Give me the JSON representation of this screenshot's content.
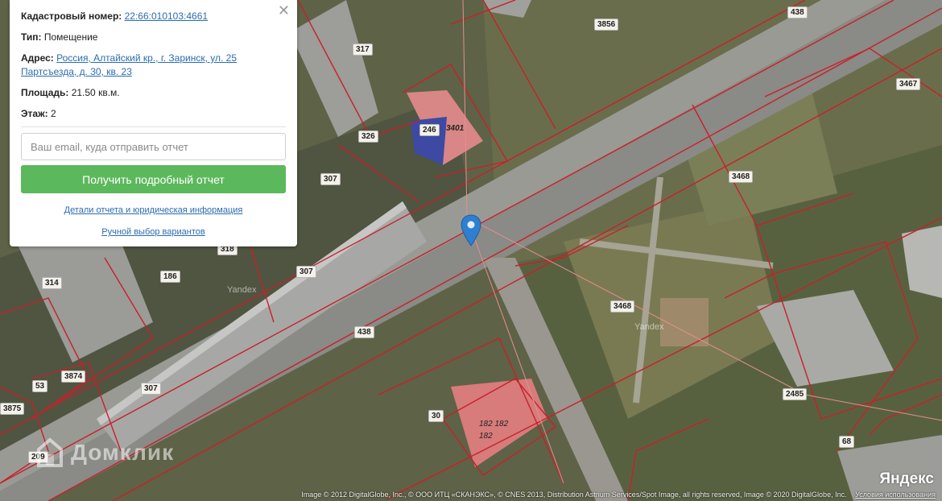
{
  "popup": {
    "cadastral_label": "Кадастровый номер:",
    "cadastral_value": "22:66:010103:4661",
    "type_label": "Тип:",
    "type_value": "Помещение",
    "address_label": "Адрес:",
    "address_value": "Россия, Алтайский кр., г. Заринск, ул. 25 Партсъезда, д. 30, кв. 23",
    "area_label": "Площадь:",
    "area_value": "21.50 кв.м.",
    "floor_label": "Этаж:",
    "floor_value": "2",
    "email_placeholder": "Ваш email, куда отправить отчет",
    "button_label": "Получить подробный отчет",
    "details_link": "Детали отчета и юридическая информация",
    "manual_link": "Ручной выбор вариантов",
    "close_glyph": "✕"
  },
  "plot_labels": [
    "3856",
    "438",
    "317",
    "3467",
    "246",
    "3401",
    "326",
    "307",
    "3468",
    "318",
    "186",
    "314",
    "307",
    "3468",
    "438",
    "3874",
    "53",
    "307",
    "3875",
    "209",
    "30",
    "182 182",
    "182",
    "2485",
    "68"
  ],
  "watermarks": {
    "domclick": "Домклик",
    "yandex_logo": "Яндекс",
    "yandex_small_1": "Yandex",
    "yandex_small_2": "Yandex"
  },
  "attribution": {
    "text": "Image © 2012 DigitalGlobe, Inc., © ООО ИТЦ «СКАНЭКС», © CNES 2013, Distribution Astrium Services/Spot Image, all rights reserved, Image © 2020 DigitalGlobe, Inc.",
    "terms_link": "Условия использования"
  },
  "colors": {
    "boundary": "#c8202a",
    "button": "#5cb85c",
    "link": "#2b6cb0",
    "pin": "#2e7fd0"
  },
  "icons": {
    "pin": "map-marker-icon",
    "close": "close-icon"
  }
}
